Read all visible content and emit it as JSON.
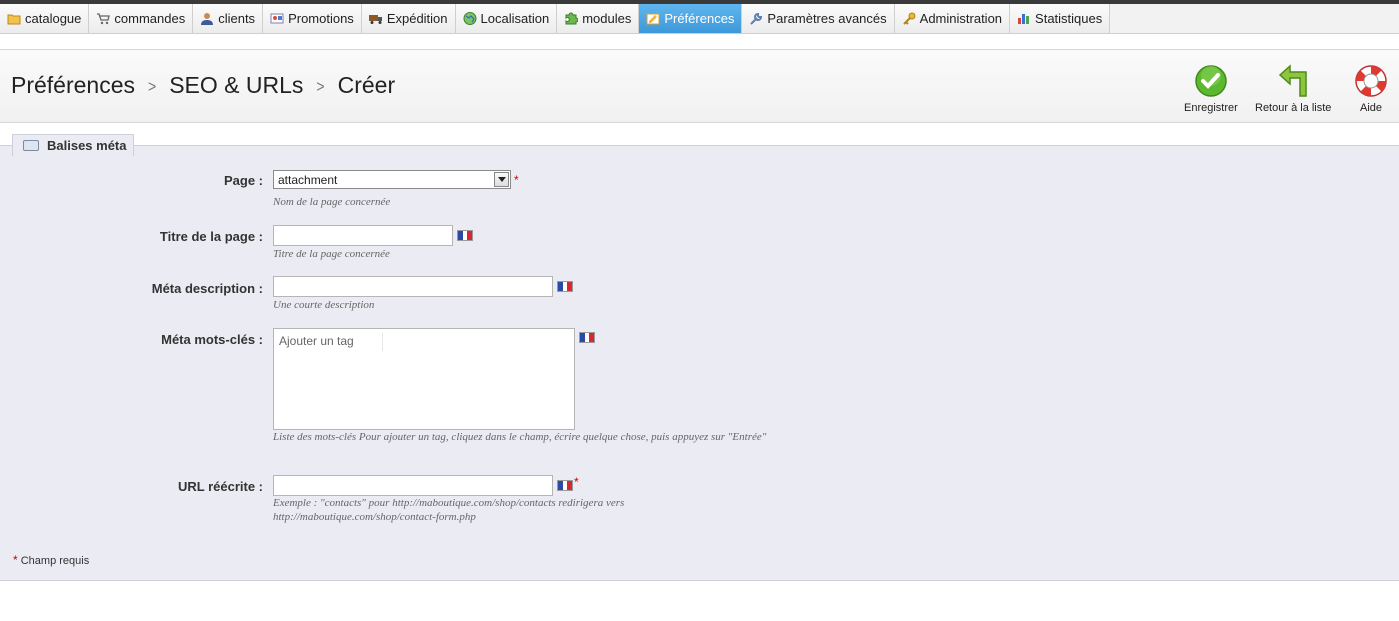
{
  "menu": [
    {
      "label": "catalogue",
      "icon": "folder-icon"
    },
    {
      "label": "commandes",
      "icon": "cart-icon"
    },
    {
      "label": "clients",
      "icon": "user-icon"
    },
    {
      "label": "Promotions",
      "icon": "promotion-icon"
    },
    {
      "label": "Expédition",
      "icon": "truck-icon"
    },
    {
      "label": "Localisation",
      "icon": "globe-icon"
    },
    {
      "label": "modules",
      "icon": "puzzle-icon"
    },
    {
      "label": "Préférences",
      "icon": "preferences-icon",
      "active": true
    },
    {
      "label": "Paramètres avancés",
      "icon": "wrench-icon"
    },
    {
      "label": "Administration",
      "icon": "key-icon"
    },
    {
      "label": "Statistiques",
      "icon": "bar-chart-icon"
    }
  ],
  "breadcrumb": [
    "Préférences",
    "SEO & URLs",
    "Créer"
  ],
  "toolbar": {
    "save_label": "Enregistrer",
    "back_label": "Retour à la liste",
    "help_label": "Aide"
  },
  "fieldset": {
    "legend": "Balises méta"
  },
  "form": {
    "page": {
      "label": "Page :",
      "value": "attachment",
      "hint": "Nom de la page concernée"
    },
    "title": {
      "label": "Titre de la page :",
      "value": "",
      "hint": "Titre de la page concernée"
    },
    "description": {
      "label": "Méta description :",
      "value": "",
      "hint": "Une courte description"
    },
    "keywords": {
      "label": "Méta mots-clés :",
      "placeholder": "Ajouter un tag",
      "hint": "Liste des mots-clés Pour ajouter un tag, cliquez dans le champ, écrire quelque chose, puis appuyez sur \"Entrée\""
    },
    "url": {
      "label": "URL réécrite :",
      "value": "",
      "hint": "Exemple : \"contacts\" pour http://maboutique.com/shop/contacts redirigera vers http://maboutique.com/shop/contact-form.php"
    }
  },
  "required_mark": "*",
  "required_note": "Champ requis",
  "colors": {
    "accent": "#3d98d9",
    "panel": "#ebebf3",
    "required": "#cc0000"
  }
}
